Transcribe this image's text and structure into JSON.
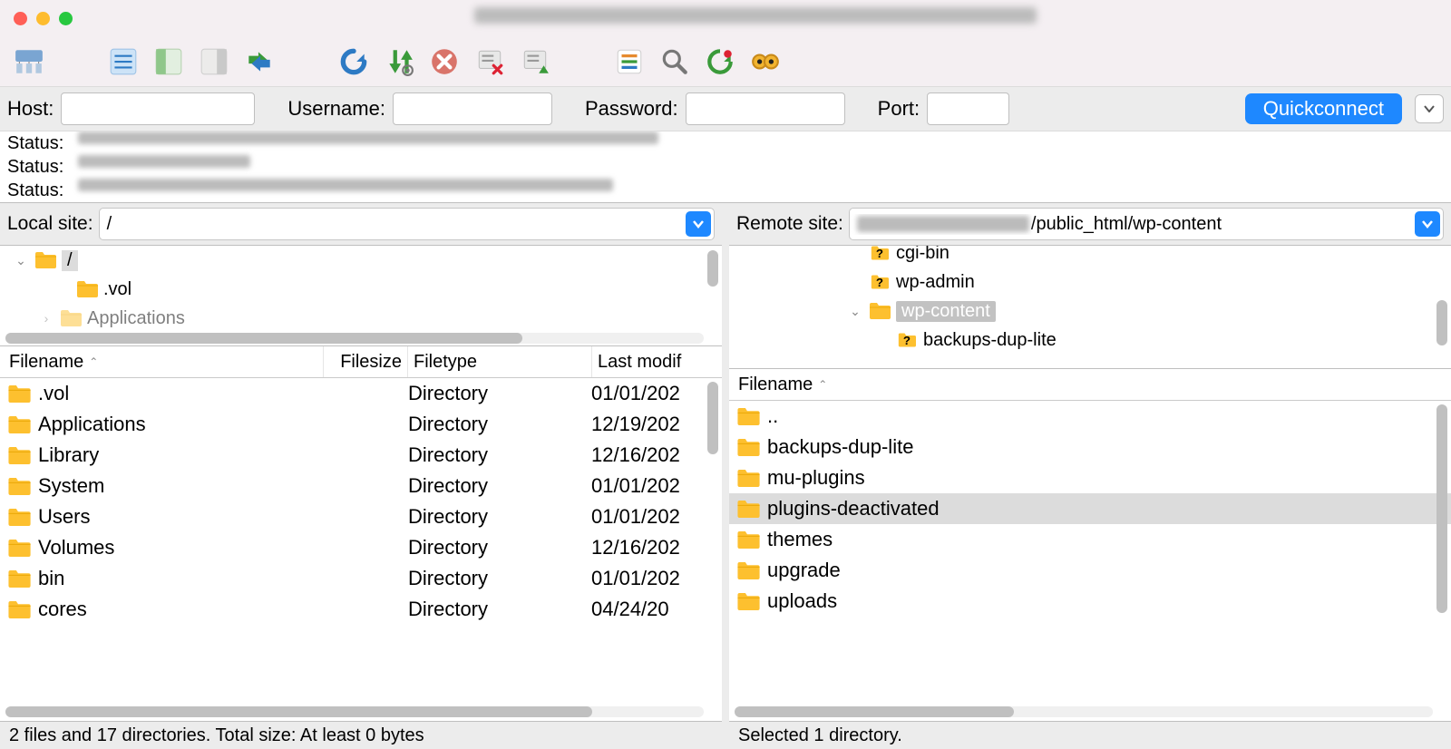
{
  "quickbar": {
    "host_label": "Host:",
    "user_label": "Username:",
    "pass_label": "Password:",
    "port_label": "Port:",
    "quickconnect": "Quickconnect"
  },
  "log": {
    "status": "Status:"
  },
  "local": {
    "label": "Local site:",
    "path": "/",
    "tree": {
      "root": "/",
      "items": [
        ".vol",
        "Applications"
      ]
    },
    "columns": {
      "filename": "Filename",
      "filesize": "Filesize",
      "filetype": "Filetype",
      "lastmod": "Last modif"
    },
    "files": [
      {
        "name": ".vol",
        "type": "Directory",
        "mod": "01/01/202"
      },
      {
        "name": "Applications",
        "type": "Directory",
        "mod": "12/19/202"
      },
      {
        "name": "Library",
        "type": "Directory",
        "mod": "12/16/202"
      },
      {
        "name": "System",
        "type": "Directory",
        "mod": "01/01/202"
      },
      {
        "name": "Users",
        "type": "Directory",
        "mod": "01/01/202"
      },
      {
        "name": "Volumes",
        "type": "Directory",
        "mod": "12/16/202"
      },
      {
        "name": "bin",
        "type": "Directory",
        "mod": "01/01/202"
      },
      {
        "name": "cores",
        "type": "Directory",
        "mod": "04/24/20"
      }
    ],
    "status": "2 files and 17 directories. Total size: At least 0 bytes"
  },
  "remote": {
    "label": "Remote site:",
    "path_visible": "/public_html/wp-content",
    "tree": {
      "items": [
        {
          "name": "cgi-bin",
          "icon": "q",
          "indent": 2
        },
        {
          "name": "wp-admin",
          "icon": "q",
          "indent": 2
        },
        {
          "name": "wp-content",
          "icon": "f",
          "indent": 2,
          "selected": true,
          "expanded": true
        },
        {
          "name": "backups-dup-lite",
          "icon": "q",
          "indent": 3
        }
      ]
    },
    "columns": {
      "filename": "Filename"
    },
    "files": [
      {
        "name": ".."
      },
      {
        "name": "backups-dup-lite"
      },
      {
        "name": "mu-plugins"
      },
      {
        "name": "plugins-deactivated",
        "selected": true
      },
      {
        "name": "themes"
      },
      {
        "name": "upgrade"
      },
      {
        "name": "uploads"
      }
    ],
    "status": "Selected 1 directory."
  }
}
